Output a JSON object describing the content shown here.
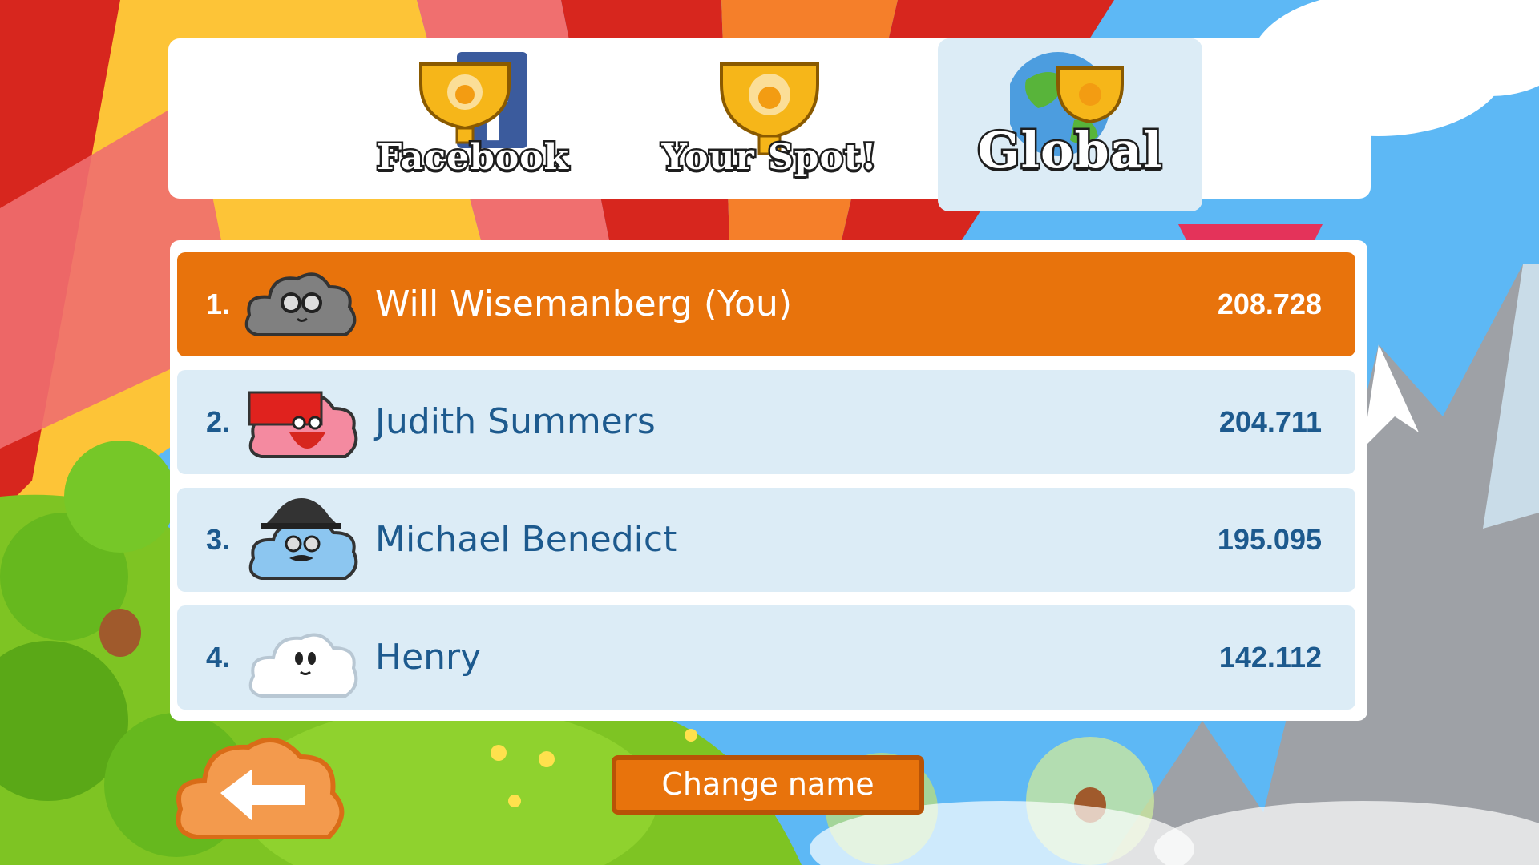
{
  "tabs": [
    {
      "label": "Facebook",
      "icon": "facebook-trophy-icon",
      "active": false
    },
    {
      "label": "Your Spot!",
      "icon": "trophy-icon",
      "active": false
    },
    {
      "label": "Global",
      "icon": "globe-trophy-icon",
      "active": true
    }
  ],
  "leaderboard": [
    {
      "rank": "1.",
      "name": "Will Wisemanberg (You)",
      "score": "208.728",
      "avatar": "gray-cloud-sunglasses-avatar",
      "highlight": true
    },
    {
      "rank": "2.",
      "name": "Judith Summers",
      "score": "204.711",
      "avatar": "red-cloud-ninja-avatar",
      "highlight": false
    },
    {
      "rank": "3.",
      "name": "Michael Benedict",
      "score": "195.095",
      "avatar": "blue-cloud-fedora-avatar",
      "highlight": false
    },
    {
      "rank": "4.",
      "name": "Henry",
      "score": "142.112",
      "avatar": "white-cloud-avatar",
      "highlight": false
    }
  ],
  "buttons": {
    "change_name": "Change name",
    "back": "back-arrow-icon"
  },
  "colors": {
    "highlight_row": "#e8730c",
    "row": "#dcecf6",
    "text": "#1d5a8e",
    "sky": "#5db8f5"
  }
}
